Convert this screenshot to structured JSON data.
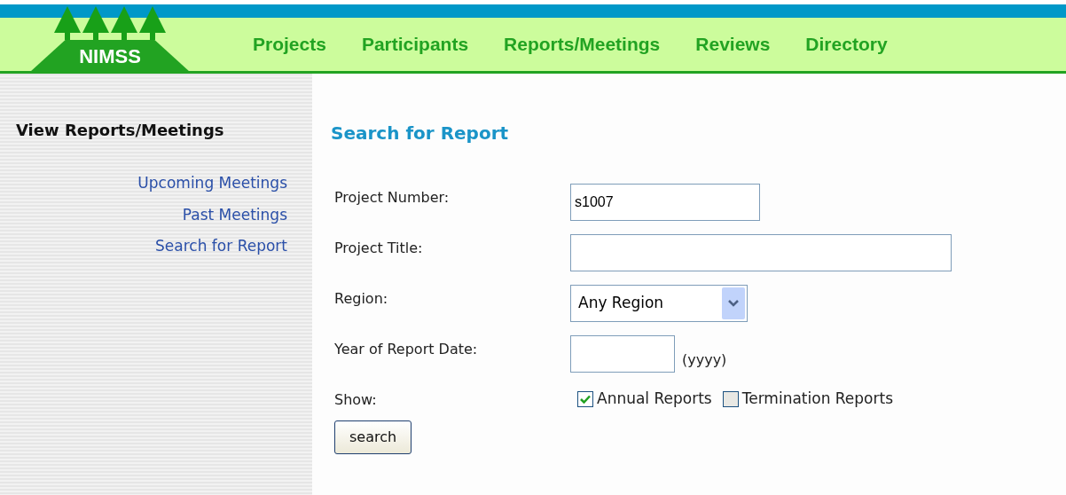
{
  "logo": {
    "text": "NIMSS"
  },
  "nav": [
    {
      "label": "Projects"
    },
    {
      "label": "Participants"
    },
    {
      "label": "Reports/Meetings"
    },
    {
      "label": "Reviews"
    },
    {
      "label": "Directory"
    }
  ],
  "sidebar": {
    "title": "View Reports/Meetings",
    "links": [
      {
        "label": "Upcoming Meetings"
      },
      {
        "label": "Past Meetings"
      },
      {
        "label": "Search for Report"
      }
    ]
  },
  "form": {
    "title": "Search for Report",
    "rows": [
      {
        "kind": "text",
        "label": "Project Number:",
        "value": "s1007"
      },
      {
        "kind": "wide_text",
        "label": "Project Title:"
      },
      {
        "kind": "select",
        "label": "Region:",
        "value": "Any Region"
      },
      {
        "kind": "year",
        "label": "Year of Report Date:",
        "hint": "(yyyy)"
      },
      {
        "kind": "checks",
        "label": "Show:",
        "options": [
          {
            "label": "Annual Reports",
            "checked": true
          },
          {
            "label": "Termination Reports",
            "checked": false
          }
        ]
      }
    ],
    "button": "search"
  }
}
